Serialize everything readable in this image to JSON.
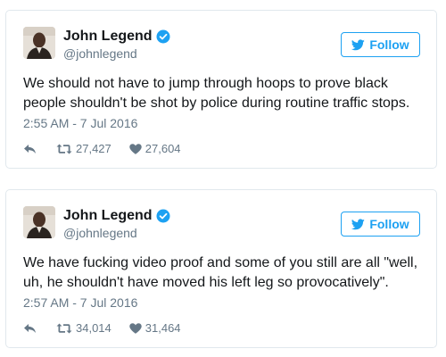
{
  "colors": {
    "accent": "#1da1f2",
    "text": "#14171a",
    "muted": "#657786",
    "border": "#e1e8ed"
  },
  "icons": {
    "verified": "verified-badge-icon",
    "follow": "twitter-bird-icon",
    "reply": "reply-arrow-icon",
    "retweet": "retweet-icon",
    "like": "heart-icon"
  },
  "tweets": [
    {
      "author": {
        "name": "John Legend",
        "handle": "@johnlegend",
        "verified": true
      },
      "follow_label": "Follow",
      "text": "We should not have to jump through hoops to prove black people shouldn't be shot by police during routine traffic stops.",
      "timestamp": "2:55 AM - 7 Jul 2016",
      "retweets": "27,427",
      "likes": "27,604"
    },
    {
      "author": {
        "name": "John Legend",
        "handle": "@johnlegend",
        "verified": true
      },
      "follow_label": "Follow",
      "text": "We have fucking video proof and some of you still are all \"well, uh, he shouldn't have moved his left leg so provocatively\".",
      "timestamp": "2:57 AM - 7 Jul 2016",
      "retweets": "34,014",
      "likes": "31,464"
    }
  ]
}
